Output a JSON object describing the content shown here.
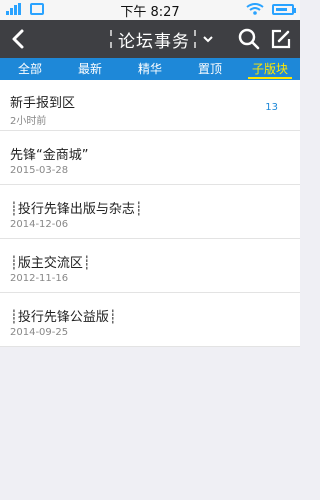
{
  "status": {
    "time": "下午 8:27"
  },
  "header": {
    "title": "论坛事务"
  },
  "tabs": [
    {
      "label": "全部",
      "active": false
    },
    {
      "label": "最新",
      "active": false
    },
    {
      "label": "精华",
      "active": false
    },
    {
      "label": "置顶",
      "active": false
    },
    {
      "label": "子版块",
      "active": true
    }
  ],
  "items": [
    {
      "title": "新手报到区",
      "date": "2小时前",
      "count": "13"
    },
    {
      "title": "先锋“金商城”",
      "date": "2015-03-28"
    },
    {
      "title": "┊投行先锋出版与杂志┊",
      "date": "2014-12-06"
    },
    {
      "title": "┊版主交流区┊",
      "date": "2012-11-16"
    },
    {
      "title": "┊投行先锋公益版┊",
      "date": "2014-09-25"
    }
  ]
}
